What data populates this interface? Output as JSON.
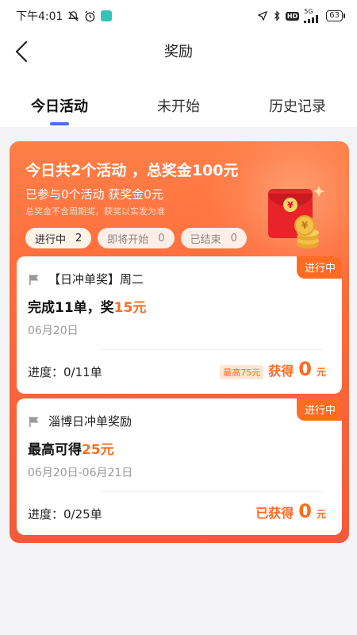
{
  "status_bar": {
    "time": "下午4:01",
    "net_top": "5G",
    "net_bottom": "4G",
    "battery": "63",
    "icons": [
      "mute-icon",
      "alarm-icon",
      "app-icon",
      "location-icon",
      "bluetooth-icon",
      "hd-icon",
      "signal-icon",
      "battery-icon"
    ]
  },
  "header": {
    "title": "奖励",
    "back_icon": "chevron-left-icon"
  },
  "tabs": [
    {
      "label": "今日活动",
      "active": true
    },
    {
      "label": "未开始",
      "active": false
    },
    {
      "label": "历史记录",
      "active": false
    }
  ],
  "summary": {
    "title": "今日共2个活动 ，总奖金100元",
    "joined": "已参与0个活动 获奖金0元",
    "note": "总奖金不含周期奖，获奖以实发为准"
  },
  "filters": [
    {
      "label": "进行中",
      "count": "2",
      "active": true
    },
    {
      "label": "即将开始",
      "count": "0",
      "active": false
    },
    {
      "label": "已结束",
      "count": "0",
      "active": false
    }
  ],
  "cards": [
    {
      "status": "进行中",
      "name": "【日冲单奖】周二",
      "reward_prefix": "完成11单，奖",
      "reward_amount": "15元",
      "date": "06月20日",
      "progress": "进度：0/11单",
      "max_badge": "最高75元",
      "result_label": "获得",
      "result_value": "0",
      "result_unit": "元"
    },
    {
      "status": "进行中",
      "name": "淄博日冲单奖励",
      "reward_prefix": "最高可得",
      "reward_amount": "25元",
      "date": "06月20日-06月21日",
      "progress": "进度：0/25单",
      "result_label": "已获得",
      "result_value": "0",
      "result_unit": "元"
    }
  ],
  "colors": {
    "accent": "#ff6b21",
    "banner": "#ff6a3a",
    "tab_indicator": "#4a6cf7",
    "envelope": "#e8232a",
    "coin": "#f5c04a"
  }
}
